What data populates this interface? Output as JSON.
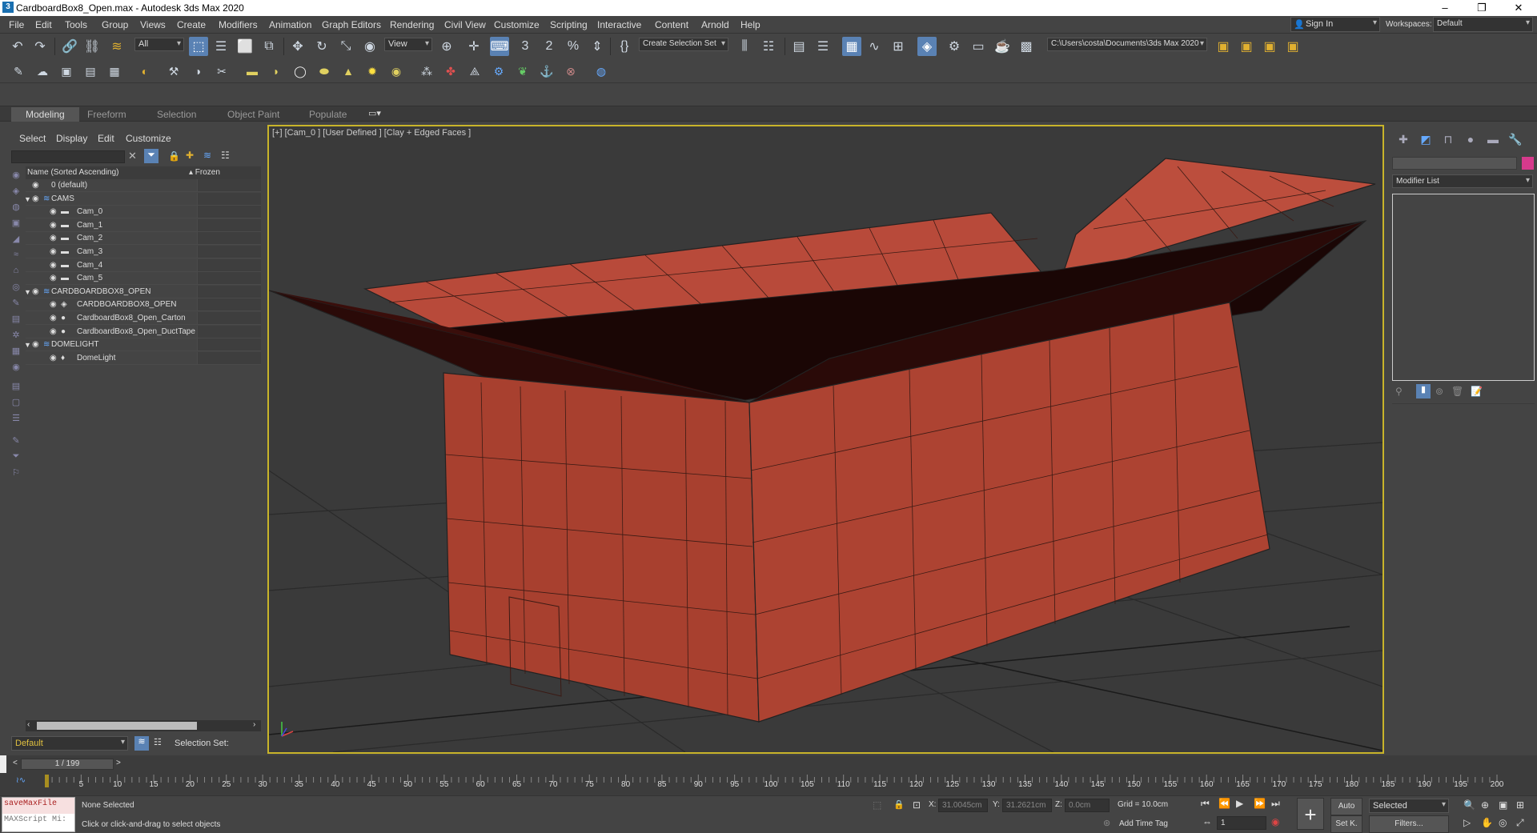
{
  "window": {
    "title": "CardboardBox8_Open.max - Autodesk 3ds Max 2020",
    "app_icon_letter": "3"
  },
  "menu": [
    "File",
    "Edit",
    "Tools",
    "Group",
    "Views",
    "Create",
    "Modifiers",
    "Animation",
    "Graph Editors",
    "Rendering",
    "Civil View",
    "Customize",
    "Scripting",
    "Interactive",
    "Content",
    "Arnold",
    "Help"
  ],
  "account": {
    "sign_in": "Sign In",
    "workspaces_label": "Workspaces:",
    "workspace_value": "Default"
  },
  "toolbar": {
    "filter_value": "All",
    "ref_coord_value": "View",
    "selection_set_placeholder": "Create Selection Set",
    "project_path": "C:\\Users\\costa\\Documents\\3ds Max 2020",
    "snaps_value": "3",
    "angle_snap_value": "2"
  },
  "ribbon": {
    "tabs": [
      "Modeling",
      "Freeform",
      "Selection",
      "Object Paint",
      "Populate"
    ],
    "active": "Modeling"
  },
  "scene_explorer": {
    "menu": [
      "Select",
      "Display",
      "Edit",
      "Customize"
    ],
    "col_name": "Name (Sorted Ascending)",
    "col_frozen": "▴ Frozen",
    "rows": [
      {
        "label": "0 (default)",
        "depth": 0,
        "kind": "layer",
        "expand": ""
      },
      {
        "label": "CAMS",
        "depth": 0,
        "kind": "layer",
        "expand": "▼"
      },
      {
        "label": "Cam_0",
        "depth": 1,
        "kind": "camera",
        "expand": ""
      },
      {
        "label": "Cam_1",
        "depth": 1,
        "kind": "camera",
        "expand": ""
      },
      {
        "label": "Cam_2",
        "depth": 1,
        "kind": "camera",
        "expand": ""
      },
      {
        "label": "Cam_3",
        "depth": 1,
        "kind": "camera",
        "expand": ""
      },
      {
        "label": "Cam_4",
        "depth": 1,
        "kind": "camera",
        "expand": ""
      },
      {
        "label": "Cam_5",
        "depth": 1,
        "kind": "camera",
        "expand": ""
      },
      {
        "label": "CARDBOARDBOX8_OPEN",
        "depth": 0,
        "kind": "layer",
        "expand": "▼"
      },
      {
        "label": "CARDBOARDBOX8_OPEN",
        "depth": 1,
        "kind": "group",
        "expand": ""
      },
      {
        "label": "CardboardBox8_Open_Carton",
        "depth": 1,
        "kind": "mesh",
        "expand": ""
      },
      {
        "label": "CardboardBox8_Open_DuctTape",
        "depth": 1,
        "kind": "mesh",
        "expand": ""
      },
      {
        "label": "DOMELIGHT",
        "depth": 0,
        "kind": "layer",
        "expand": "▼"
      },
      {
        "label": "DomeLight",
        "depth": 1,
        "kind": "light",
        "expand": ""
      }
    ],
    "layer_value": "Default",
    "selection_set_label": "Selection Set:"
  },
  "viewport": {
    "label": "[+] [Cam_0 ] [User Defined ] [Clay + Edged Faces ]"
  },
  "command_panel": {
    "modifier_list": "Modifier List",
    "color_swatch": "#d63a8c"
  },
  "timeline": {
    "frame_display": "1 / 199",
    "ticks": [
      5,
      10,
      15,
      20,
      25,
      30,
      35,
      40,
      45,
      50,
      55,
      60,
      65,
      70,
      75,
      80,
      85,
      90,
      95,
      100,
      105,
      110,
      115,
      120,
      125,
      130,
      135,
      140,
      145,
      150,
      155,
      160,
      165,
      170,
      175,
      180,
      185,
      190,
      195,
      200
    ]
  },
  "status": {
    "maxscript_line1": "saveMaxFile",
    "maxscript_line2": "MAXScript Mi:",
    "selection": "None Selected",
    "prompt": "Click or click-and-drag to select objects",
    "x_label": "X:",
    "x_value": "31.0045cm",
    "y_label": "Y:",
    "y_value": "31.2621cm",
    "z_label": "Z:",
    "z_value": "0.0cm",
    "grid": "Grid = 10.0cm",
    "add_time_tag": "Add Time Tag",
    "auto": "Auto",
    "setk": "Set K.",
    "selected": "Selected",
    "filters": "Filters...",
    "frame_value": "1"
  },
  "colors": {
    "box": "#b04535",
    "viewport_bg": "#3a3a3a",
    "active_border": "#c8b42a",
    "accent": "#5a82b4"
  }
}
